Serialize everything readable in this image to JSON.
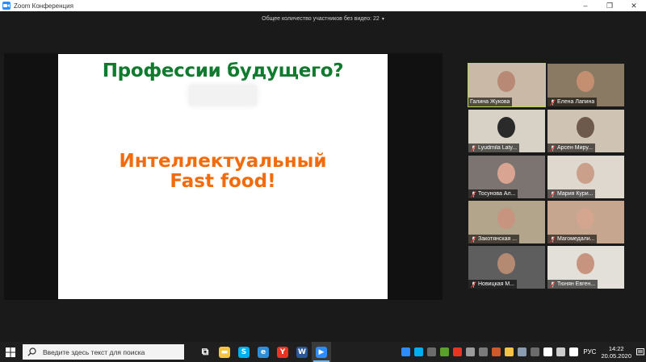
{
  "window": {
    "title": "Zoom Конференция",
    "controls": [
      "–",
      "❐",
      "✕"
    ]
  },
  "meeting": {
    "participants_without_video": "Общее количество участников без видео: 22",
    "dropdown_caret": "▾"
  },
  "slide": {
    "title": "Профессии будущего?",
    "main_line1": "Интеллектуальный",
    "main_line2": "Fast food!",
    "title_color": "#107a2f",
    "main_color": "#f26c0d"
  },
  "gallery": {
    "active_border_color": "#b6d94a",
    "participants": [
      {
        "name": "Галина Жукова",
        "active": true,
        "muted": false,
        "bg": "#c9b9a6",
        "face": "#b88a76"
      },
      {
        "name": "Елена Лапина",
        "active": false,
        "muted": true,
        "bg": "#8a7a63",
        "face": "#c48e70"
      },
      {
        "name": "Lyudmila Laty...",
        "active": false,
        "muted": true,
        "bg": "#d8d2c6",
        "face": "#2a2a2a"
      },
      {
        "name": "Арсен Миру...",
        "active": false,
        "muted": true,
        "bg": "#cfc3b4",
        "face": "#6d5a4c"
      },
      {
        "name": "Тосунова Ал...",
        "active": false,
        "muted": true,
        "bg": "#7c7470",
        "face": "#d9a592"
      },
      {
        "name": "Мария Кури...",
        "active": false,
        "muted": true,
        "bg": "#ded8cf",
        "face": "#caa08a"
      },
      {
        "name": "Закотянская ...",
        "active": false,
        "muted": true,
        "bg": "#b3a48c",
        "face": "#c79480"
      },
      {
        "name": "Магомедали...",
        "active": false,
        "muted": true,
        "bg": "#c6a68f",
        "face": "#d4a58f"
      },
      {
        "name": "Новицкая М...",
        "active": false,
        "muted": true,
        "bg": "#5e5e5e",
        "face": "#b48a72"
      },
      {
        "name": "Тюнян Евген...",
        "active": false,
        "muted": true,
        "bg": "#e3dfd9",
        "face": "#c79480"
      }
    ]
  },
  "taskbar": {
    "search_placeholder": "Введите здесь текст для поиска",
    "apps": [
      {
        "name": "task-view",
        "color": "#ffffff",
        "glyph": "⧉"
      },
      {
        "name": "file-explorer",
        "color": "#f4c542",
        "glyph": "▬"
      },
      {
        "name": "skype",
        "color": "#00aff0",
        "glyph": "S"
      },
      {
        "name": "edge",
        "color": "#2e8fd8",
        "glyph": "e"
      },
      {
        "name": "yandex-browser",
        "color": "#e93323",
        "glyph": "Y"
      },
      {
        "name": "word",
        "color": "#2b579a",
        "glyph": "W"
      },
      {
        "name": "zoom",
        "color": "#2d8cff",
        "glyph": "▶",
        "active": true
      }
    ],
    "tray_colors": [
      "#2d8cff",
      "#00aff0",
      "#6c6c6c",
      "#5aa02c",
      "#e93323",
      "#9b9b9b",
      "#7a7a7a",
      "#cc5a2a",
      "#f4c542",
      "#8b9bb0",
      "#6c6c6c",
      "#ffffff",
      "#cccccc",
      "#ffffff"
    ],
    "language": "РУС",
    "time": "14:22",
    "date": "20.05.2020"
  }
}
